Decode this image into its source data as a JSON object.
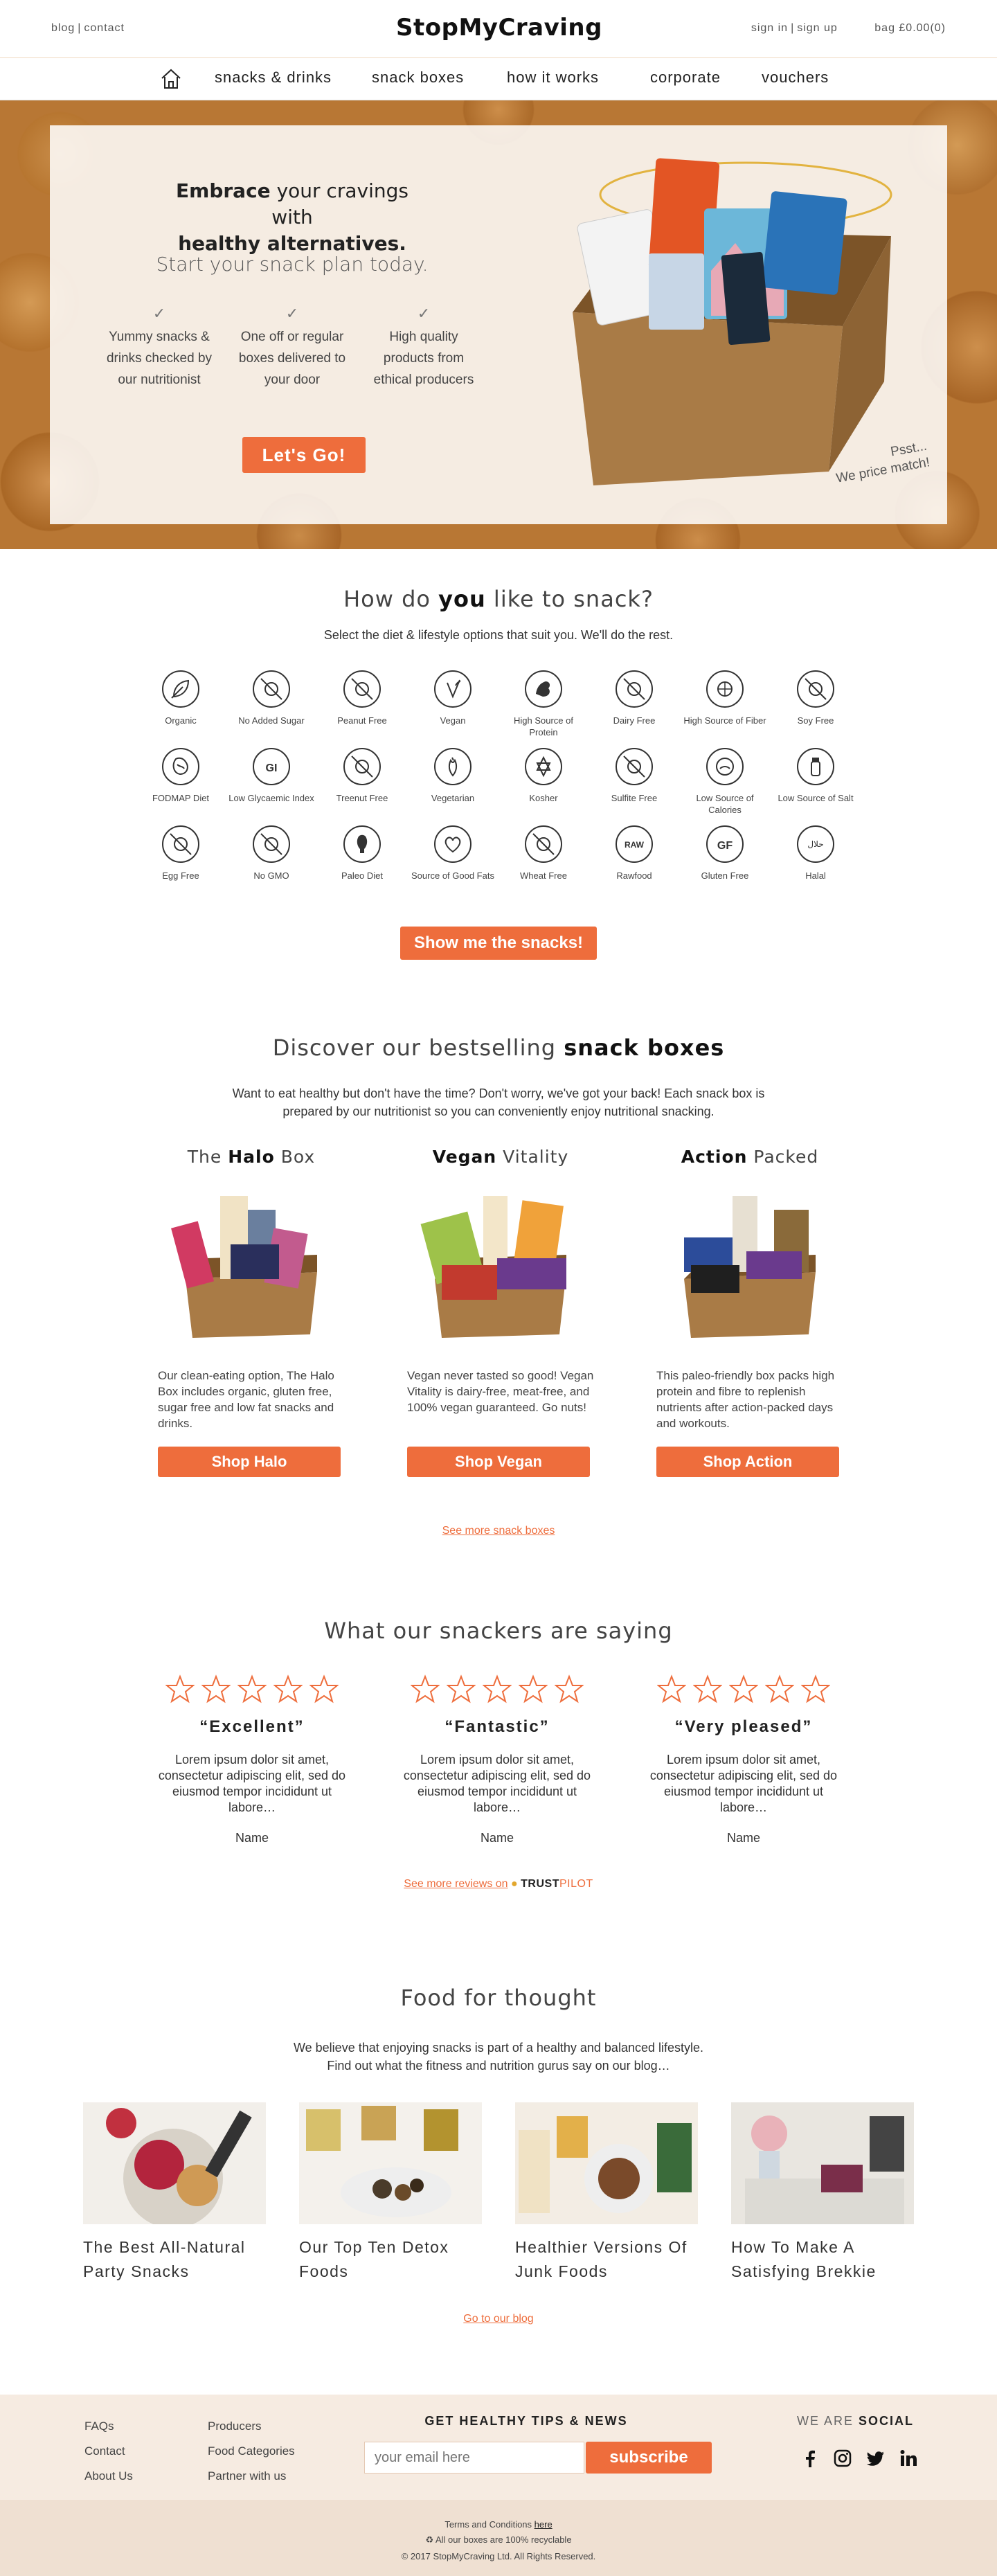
{
  "header": {
    "blog": "blog",
    "contact": "contact",
    "logo": "StopMyCraving",
    "sign_in": "sign in",
    "sign_up": "sign up",
    "bag": "bag £0.00(0)"
  },
  "nav": {
    "items": [
      "snacks & drinks",
      "snack boxes",
      "how it works",
      "corporate",
      "vouchers"
    ]
  },
  "hero": {
    "headline_bold1": "Embrace",
    "headline_rest": " your cravings with",
    "headline_bold2": "healthy alternatives.",
    "subheadline": "Start your snack plan today.",
    "benefits": [
      "Yummy snacks & drinks checked by our nutritionist",
      "One off or regular boxes delivered to your door",
      "High quality products from ethical producers"
    ],
    "cta": "Let's Go!",
    "price_match_1": "Psst...",
    "price_match_2": "We price match!"
  },
  "diet": {
    "title_pre": "How do ",
    "title_bold": "you",
    "title_post": " like to snack?",
    "subtitle": "Select the diet & lifestyle options that suit you. We'll do the rest.",
    "options": [
      {
        "label": "Organic",
        "icon": "leaf-icon"
      },
      {
        "label": "No Added Sugar",
        "icon": "no-sugar-icon"
      },
      {
        "label": "Peanut Free",
        "icon": "peanut-free-icon"
      },
      {
        "label": "Vegan",
        "icon": "vegan-icon"
      },
      {
        "label": "High Source of Protein",
        "icon": "protein-icon"
      },
      {
        "label": "Dairy Free",
        "icon": "dairy-free-icon"
      },
      {
        "label": "High Source of Fiber",
        "icon": "fiber-icon"
      },
      {
        "label": "Soy Free",
        "icon": "soy-free-icon"
      },
      {
        "label": "FODMAP Diet",
        "icon": "fodmap-icon"
      },
      {
        "label": "Low Glycaemic Index",
        "icon": "low-gi-icon"
      },
      {
        "label": "Treenut Free",
        "icon": "treenut-free-icon"
      },
      {
        "label": "Vegetarian",
        "icon": "vegetarian-icon"
      },
      {
        "label": "Kosher",
        "icon": "kosher-icon"
      },
      {
        "label": "Sulfite Free",
        "icon": "sulfite-free-icon"
      },
      {
        "label": "Low Source of Calories",
        "icon": "low-calories-icon"
      },
      {
        "label": "Low Source of Salt",
        "icon": "low-salt-icon"
      },
      {
        "label": "Egg Free",
        "icon": "egg-free-icon"
      },
      {
        "label": "No GMO",
        "icon": "no-gmo-icon"
      },
      {
        "label": "Paleo Diet",
        "icon": "paleo-icon"
      },
      {
        "label": "Source of Good Fats",
        "icon": "good-fats-icon"
      },
      {
        "label": "Wheat Free",
        "icon": "wheat-free-icon"
      },
      {
        "label": "Rawfood",
        "icon": "raw-icon"
      },
      {
        "label": "Gluten Free",
        "icon": "gluten-free-icon"
      },
      {
        "label": "Halal",
        "icon": "halal-icon"
      }
    ],
    "gi_text": "GI",
    "raw_text": "RAW",
    "gf_text": "GF",
    "cta": "Show me the snacks!"
  },
  "boxes": {
    "title_pre": "Discover our bestselling ",
    "title_bold": "snack boxes",
    "intro": "Want to eat healthy but don't have the time? Don't worry, we've got your back! Each snack box is prepared by our nutritionist so you can conveniently enjoy nutritional snacking.",
    "items": [
      {
        "title_pre": "The ",
        "title_bold": "Halo",
        "title_post": " Box",
        "desc": "Our clean-eating option, The Halo Box includes organic, gluten free, sugar free and low fat snacks and drinks.",
        "cta": "Shop Halo"
      },
      {
        "title_pre": "",
        "title_bold": "Vegan",
        "title_post": " Vitality",
        "desc": "Vegan never tasted so good! Vegan Vitality is dairy-free, meat-free, and 100% vegan guaranteed. Go nuts!",
        "cta": "Shop Vegan"
      },
      {
        "title_pre": "",
        "title_bold": "Action",
        "title_post": " Packed",
        "desc": "This paleo-friendly box packs high protein and fibre to replenish nutrients after action-packed days and workouts.",
        "cta": "Shop Action"
      }
    ],
    "see_more": "See more snack boxes"
  },
  "reviews": {
    "title": "What our snackers are saying",
    "items": [
      {
        "rating": 5,
        "title": "“Excellent”",
        "body": "Lorem ipsum dolor sit amet, consectetur adipiscing elit, sed do eiusmod tempor incididunt ut labore…",
        "name": "Name"
      },
      {
        "rating": 5,
        "title": "“Fantastic”",
        "body": "Lorem ipsum dolor sit amet, consectetur adipiscing elit, sed do eiusmod tempor incididunt ut labore…",
        "name": "Name"
      },
      {
        "rating": 5,
        "title": "“Very pleased”",
        "body": "Lorem ipsum dolor sit amet, consectetur adipiscing elit, sed do eiusmod tempor incididunt ut labore…",
        "name": "Name"
      }
    ],
    "trustpilot_link": "See more reviews on",
    "trustpilot_brand": "TRUST",
    "trustpilot_brand2": "PILOT"
  },
  "blog": {
    "title": "Food for thought",
    "intro_1": "We believe that enjoying snacks is part of a healthy and balanced lifestyle.",
    "intro_2": "Find out what the fitness and nutrition gurus say on our blog…",
    "posts": [
      {
        "title": "The Best All-Natural Party Snacks"
      },
      {
        "title": "Our Top Ten Detox Foods"
      },
      {
        "title": "Healthier Versions Of Junk Foods"
      },
      {
        "title": "How To Make A Satisfying Brekkie"
      }
    ],
    "cta": "Go to our blog"
  },
  "footer": {
    "col1": [
      "FAQs",
      "Contact",
      "About Us"
    ],
    "col2": [
      "Producers",
      "Food Categories",
      "Partner with us"
    ],
    "newsletter_title": "GET HEALTHY TIPS & NEWS",
    "email_placeholder": "your email here",
    "subscribe": "subscribe",
    "social_pre": "WE ARE ",
    "social_bold": "SOCIAL",
    "terms_pre": "Terms and Conditions ",
    "terms_link": "here",
    "recyclable": "All our boxes are 100% recyclable",
    "copyright": "2017 StopMyCraving Ltd. All Rights Reserved."
  },
  "colors": {
    "accent": "#ee6d3c",
    "footer_bg": "#f6ebe1",
    "footer_bottom_bg": "#efe0d2"
  }
}
